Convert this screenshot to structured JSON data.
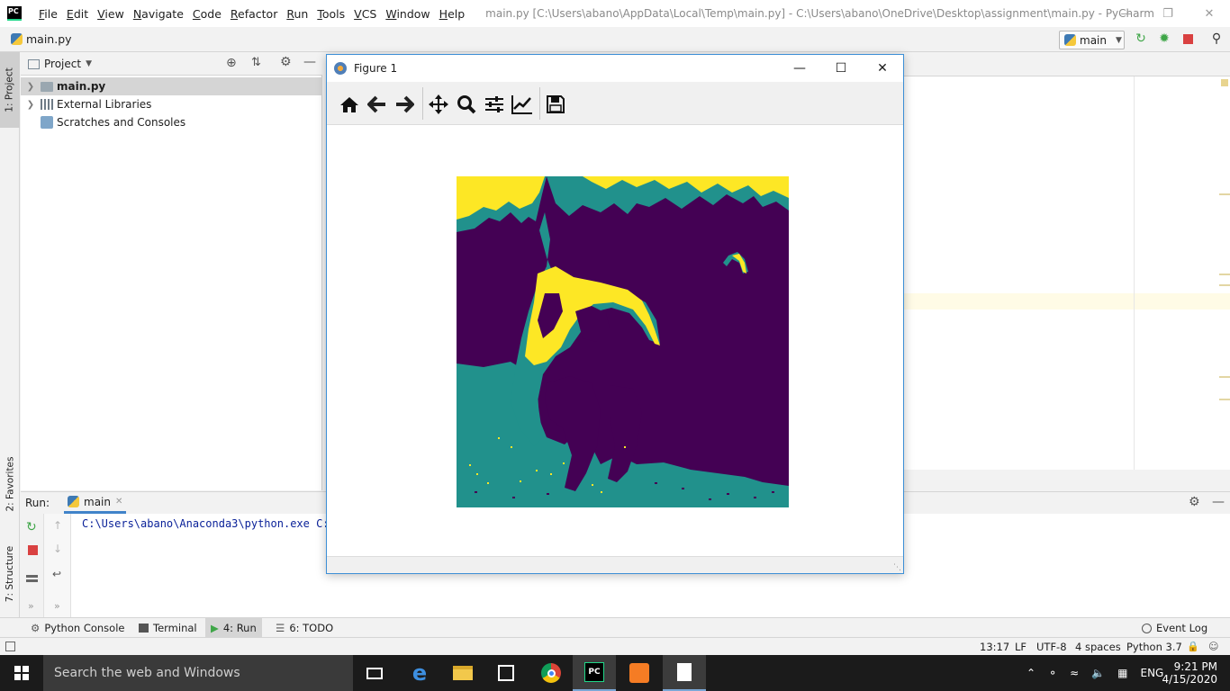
{
  "window": {
    "title": "main.py [C:\\Users\\abano\\AppData\\Local\\Temp\\main.py] - C:\\Users\\abano\\OneDrive\\Desktop\\assignment\\main.py - PyCharm",
    "app_logo_text": "PC"
  },
  "menu": [
    {
      "label": "File",
      "mnemonic": "F",
      "rest": "ile"
    },
    {
      "label": "Edit",
      "mnemonic": "E",
      "rest": "dit"
    },
    {
      "label": "View",
      "mnemonic": "V",
      "rest": "iew"
    },
    {
      "label": "Navigate",
      "mnemonic": "N",
      "rest": "avigate"
    },
    {
      "label": "Code",
      "mnemonic": "C",
      "rest": "ode"
    },
    {
      "label": "Refactor",
      "mnemonic": "R",
      "rest": "efactor"
    },
    {
      "label": "Run",
      "mnemonic": "R",
      "rest": "un"
    },
    {
      "label": "Tools",
      "mnemonic": "T",
      "rest": "ools"
    },
    {
      "label": "VCS",
      "mnemonic": "V",
      "rest": "CS"
    },
    {
      "label": "Window",
      "mnemonic": "W",
      "rest": "indow"
    },
    {
      "label": "Help",
      "mnemonic": "H",
      "rest": "elp"
    }
  ],
  "navbar": {
    "breadcrumb_file": "main.py",
    "run_config": "main"
  },
  "left_tool_tabs": {
    "project": "1: Project",
    "favorites": "2: Favorites",
    "structure": "7: Structure"
  },
  "project_panel": {
    "title": "Project",
    "items": [
      {
        "label": "main.py",
        "selected": true
      },
      {
        "label": "External Libraries",
        "selected": false
      },
      {
        "label": "Scratches and Consoles",
        "selected": false
      }
    ]
  },
  "run_panel": {
    "label": "Run:",
    "tab": "main",
    "console_line": "C:\\Users\\abano\\Anaconda3\\python.exe C:/"
  },
  "figure": {
    "title": "Figure 1",
    "toolbar": [
      "home-icon",
      "back-icon",
      "forward-icon",
      "pan-icon",
      "zoom-icon",
      "configure-subplots-icon",
      "edit-axis-icon",
      "save-icon"
    ],
    "colors": {
      "dark": "#440154",
      "mid": "#21918c",
      "light": "#fde725"
    }
  },
  "bottom_tabs": [
    {
      "label": "Python Console",
      "active": false
    },
    {
      "label": "Terminal",
      "active": false
    },
    {
      "label": "4: Run",
      "active": true
    },
    {
      "label": "6: TODO",
      "active": false
    }
  ],
  "event_log": "Event Log",
  "status_bar": {
    "position": "13:17",
    "line_sep": "LF",
    "encoding": "UTF-8",
    "indent": "4 spaces",
    "interpreter": "Python 3.7"
  },
  "taskbar": {
    "search_placeholder": "Search the web and Windows",
    "language": "ENG",
    "time": "9:21 PM",
    "date": "4/15/2020"
  }
}
